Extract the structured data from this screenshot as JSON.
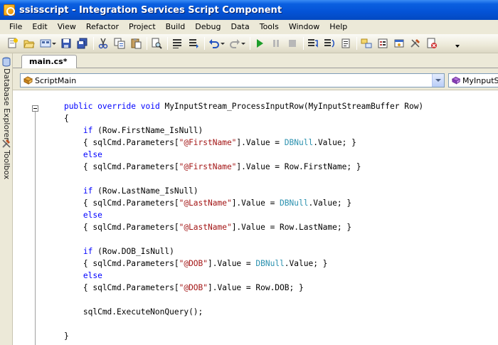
{
  "window": {
    "title": "ssisscript - Integration Services Script Component"
  },
  "menu": [
    "File",
    "Edit",
    "View",
    "Refactor",
    "Project",
    "Build",
    "Debug",
    "Data",
    "Tools",
    "Window",
    "Help"
  ],
  "toolbar": {
    "icons": [
      "add-item-icon",
      "open-file-icon",
      "new-project-icon",
      "save-icon",
      "save-all-icon",
      "cut-icon",
      "copy-icon",
      "paste-icon",
      "find-icon",
      "comment-icon",
      "uncomment-icon",
      "undo-icon",
      "redo-icon",
      "start-debug-icon",
      "pause-icon",
      "stop-icon",
      "step-into-icon",
      "step-over-icon",
      "step-out-icon",
      "solution-explorer-icon",
      "properties-icon",
      "object-browser-icon",
      "toolbox-icon",
      "error-list-icon"
    ]
  },
  "side_panels": {
    "database_explorer": "Database Explorer",
    "toolbox": "Toolbox"
  },
  "document": {
    "tab_label": "main.cs*"
  },
  "navigation": {
    "class_combo": "ScriptMain",
    "member_combo": "MyInputStream_ProcessInputRow(MyInputStreamBuffer Row)",
    "member_combo_visible": "MyInputSt"
  },
  "colors": {
    "keyword": "#0000ff",
    "string": "#a31515",
    "type": "#2b91af",
    "titlebar": "#0453d6",
    "chrome": "#ece9d8"
  },
  "code": {
    "lines": [
      [
        {
          "t": "    "
        },
        {
          "t": "public",
          "k": "kw"
        },
        {
          "t": " "
        },
        {
          "t": "override",
          "k": "kw"
        },
        {
          "t": " "
        },
        {
          "t": "void",
          "k": "kw"
        },
        {
          "t": " MyInputStream_ProcessInputRow(MyInputStreamBuffer Row)"
        }
      ],
      [
        {
          "t": "    {"
        }
      ],
      [
        {
          "t": "        "
        },
        {
          "t": "if",
          "k": "kw"
        },
        {
          "t": " (Row.FirstName_IsNull)"
        }
      ],
      [
        {
          "t": "        { sqlCmd.Parameters["
        },
        {
          "t": "\"@FirstName\"",
          "k": "str"
        },
        {
          "t": "].Value = "
        },
        {
          "t": "DBNull",
          "k": "type"
        },
        {
          "t": ".Value; }"
        }
      ],
      [
        {
          "t": "        "
        },
        {
          "t": "else",
          "k": "kw"
        }
      ],
      [
        {
          "t": "        { sqlCmd.Parameters["
        },
        {
          "t": "\"@FirstName\"",
          "k": "str"
        },
        {
          "t": "].Value = Row.FirstName; }"
        }
      ],
      [
        {
          "t": ""
        }
      ],
      [
        {
          "t": "        "
        },
        {
          "t": "if",
          "k": "kw"
        },
        {
          "t": " (Row.LastName_IsNull)"
        }
      ],
      [
        {
          "t": "        { sqlCmd.Parameters["
        },
        {
          "t": "\"@LastName\"",
          "k": "str"
        },
        {
          "t": "].Value = "
        },
        {
          "t": "DBNull",
          "k": "type"
        },
        {
          "t": ".Value; }"
        }
      ],
      [
        {
          "t": "        "
        },
        {
          "t": "else",
          "k": "kw"
        }
      ],
      [
        {
          "t": "        { sqlCmd.Parameters["
        },
        {
          "t": "\"@LastName\"",
          "k": "str"
        },
        {
          "t": "].Value = Row.LastName; }"
        }
      ],
      [
        {
          "t": ""
        }
      ],
      [
        {
          "t": "        "
        },
        {
          "t": "if",
          "k": "kw"
        },
        {
          "t": " (Row.DOB_IsNull)"
        }
      ],
      [
        {
          "t": "        { sqlCmd.Parameters["
        },
        {
          "t": "\"@DOB\"",
          "k": "str"
        },
        {
          "t": "].Value = "
        },
        {
          "t": "DBNull",
          "k": "type"
        },
        {
          "t": ".Value; }"
        }
      ],
      [
        {
          "t": "        "
        },
        {
          "t": "else",
          "k": "kw"
        }
      ],
      [
        {
          "t": "        { sqlCmd.Parameters["
        },
        {
          "t": "\"@DOB\"",
          "k": "str"
        },
        {
          "t": "].Value = Row.DOB; }"
        }
      ],
      [
        {
          "t": ""
        }
      ],
      [
        {
          "t": "        sqlCmd.ExecuteNonQuery();"
        }
      ],
      [
        {
          "t": ""
        }
      ],
      [
        {
          "t": "    }"
        }
      ]
    ]
  }
}
